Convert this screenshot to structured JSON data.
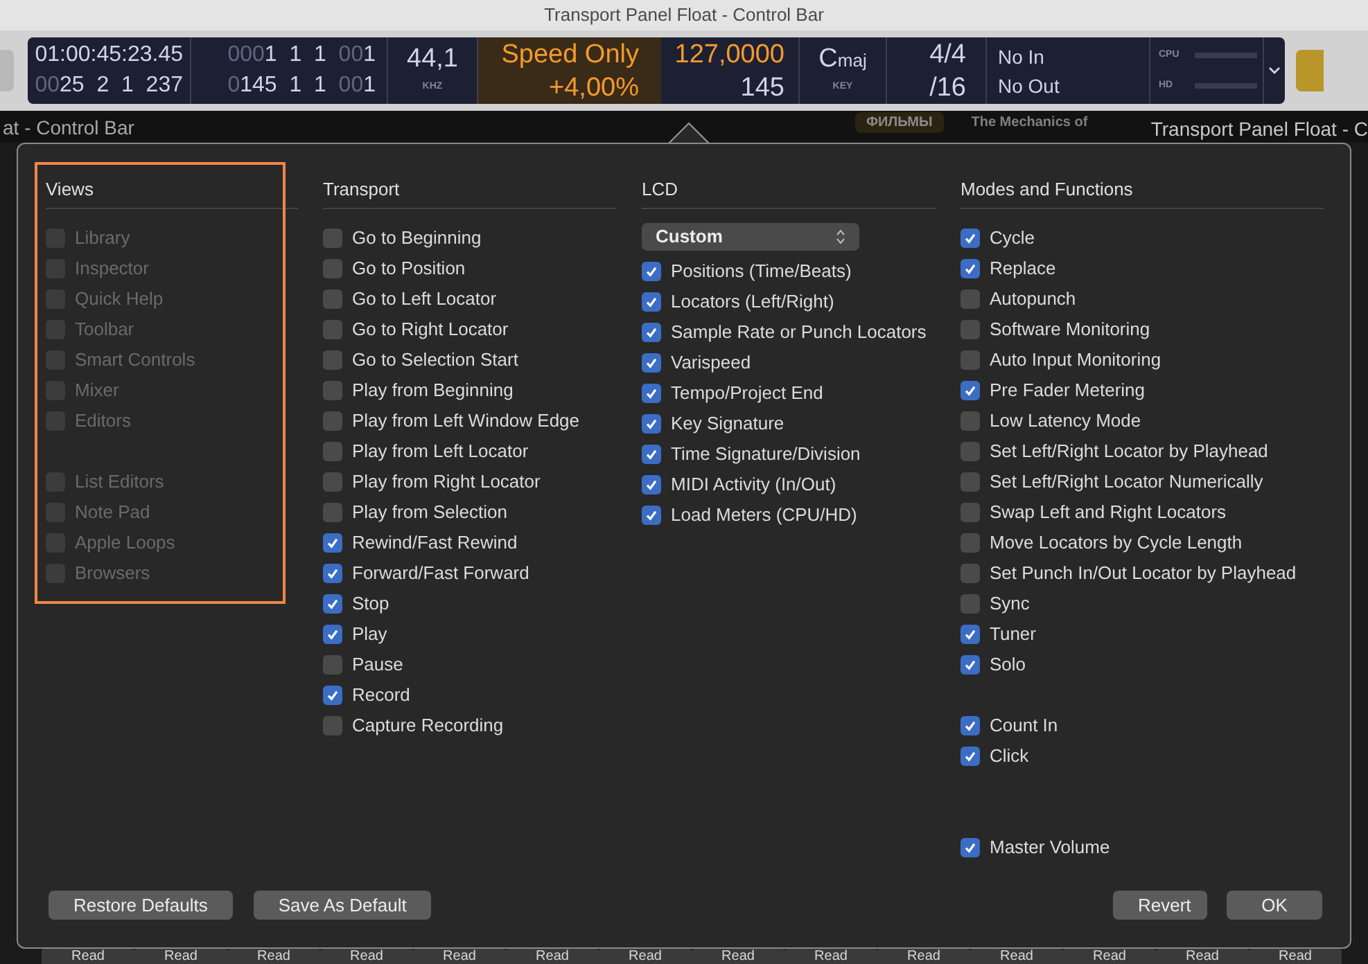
{
  "window": {
    "title": "Transport Panel Float - Control Bar"
  },
  "lcd": {
    "time": {
      "top": [
        {
          "text": "01:00:45:23.45",
          "dim": false
        }
      ],
      "bottom": [
        {
          "text": "00",
          "dim": true
        },
        {
          "text": "25  2  1  237",
          "dim": false
        }
      ]
    },
    "bars": {
      "top": [
        {
          "text": "000",
          "dim": true
        },
        {
          "text": "1  1  1  ",
          "dim": false
        },
        {
          "text": "00",
          "dim": true
        },
        {
          "text": "1",
          "dim": false
        }
      ],
      "bottom": [
        {
          "text": "0",
          "dim": true
        },
        {
          "text": "145  1  1  ",
          "dim": false
        },
        {
          "text": "00",
          "dim": true
        },
        {
          "text": "1",
          "dim": false
        }
      ]
    },
    "sample_rate": {
      "value": "44,1",
      "unit": "KHZ"
    },
    "varispeed": {
      "mode": "Speed Only",
      "value": "+4,00%"
    },
    "tempo": {
      "value": "127,0000",
      "end": "145"
    },
    "key": {
      "note": "C",
      "mode": "maj",
      "label": "KEY"
    },
    "signature": {
      "value": "4/4",
      "division": "/16"
    },
    "midi": {
      "in": "No In",
      "out": "No Out"
    },
    "meters": [
      {
        "label": "CPU"
      },
      {
        "label": "HD"
      }
    ]
  },
  "background": {
    "left_title": "at - Control Bar",
    "badge": "ФИЛЬМЫ",
    "caption": "The Mechanics of",
    "right_title": "Transport Panel Float - C",
    "track_modes": [
      "Read",
      "Read",
      "Read",
      "Read",
      "Read",
      "Read",
      "Read",
      "Read",
      "Read",
      "Read",
      "Read",
      "Read",
      "Read",
      "Read"
    ]
  },
  "dialog": {
    "views": {
      "title": "Views",
      "highlighted": true,
      "groups": [
        [
          {
            "label": "Library",
            "checked": false,
            "disabled": true
          },
          {
            "label": "Inspector",
            "checked": false,
            "disabled": true
          },
          {
            "label": "Quick Help",
            "checked": false,
            "disabled": true
          },
          {
            "label": "Toolbar",
            "checked": false,
            "disabled": true
          },
          {
            "label": "Smart Controls",
            "checked": false,
            "disabled": true
          },
          {
            "label": "Mixer",
            "checked": false,
            "disabled": true
          },
          {
            "label": "Editors",
            "checked": false,
            "disabled": true
          }
        ],
        [
          {
            "label": "List Editors",
            "checked": false,
            "disabled": true
          },
          {
            "label": "Note Pad",
            "checked": false,
            "disabled": true
          },
          {
            "label": "Apple Loops",
            "checked": false,
            "disabled": true
          },
          {
            "label": "Browsers",
            "checked": false,
            "disabled": true
          }
        ]
      ]
    },
    "transport": {
      "title": "Transport",
      "groups": [
        [
          {
            "label": "Go to Beginning",
            "checked": false,
            "disabled": false
          },
          {
            "label": "Go to Position",
            "checked": false,
            "disabled": false
          },
          {
            "label": "Go to Left Locator",
            "checked": false,
            "disabled": false
          },
          {
            "label": "Go to Right Locator",
            "checked": false,
            "disabled": false
          },
          {
            "label": "Go to Selection Start",
            "checked": false,
            "disabled": false
          },
          {
            "label": "Play from Beginning",
            "checked": false,
            "disabled": false
          },
          {
            "label": "Play from Left Window Edge",
            "checked": false,
            "disabled": false
          },
          {
            "label": "Play from Left Locator",
            "checked": false,
            "disabled": false
          },
          {
            "label": "Play from Right Locator",
            "checked": false,
            "disabled": false
          },
          {
            "label": "Play from Selection",
            "checked": false,
            "disabled": false
          },
          {
            "label": "Rewind/Fast Rewind",
            "checked": true,
            "disabled": false
          },
          {
            "label": "Forward/Fast Forward",
            "checked": true,
            "disabled": false
          },
          {
            "label": "Stop",
            "checked": true,
            "disabled": false
          },
          {
            "label": "Play",
            "checked": true,
            "disabled": false
          },
          {
            "label": "Pause",
            "checked": false,
            "disabled": false
          },
          {
            "label": "Record",
            "checked": true,
            "disabled": false
          },
          {
            "label": "Capture Recording",
            "checked": false,
            "disabled": false
          }
        ]
      ]
    },
    "lcd": {
      "title": "LCD",
      "preset": "Custom",
      "groups": [
        [
          {
            "label": "Positions (Time/Beats)",
            "checked": true,
            "disabled": false
          },
          {
            "label": "Locators (Left/Right)",
            "checked": true,
            "disabled": false
          },
          {
            "label": "Sample Rate or Punch Locators",
            "checked": true,
            "disabled": false
          },
          {
            "label": "Varispeed",
            "checked": true,
            "disabled": false
          },
          {
            "label": "Tempo/Project End",
            "checked": true,
            "disabled": false
          },
          {
            "label": "Key Signature",
            "checked": true,
            "disabled": false
          },
          {
            "label": "Time Signature/Division",
            "checked": true,
            "disabled": false
          },
          {
            "label": "MIDI Activity (In/Out)",
            "checked": true,
            "disabled": false
          },
          {
            "label": "Load Meters (CPU/HD)",
            "checked": true,
            "disabled": false
          }
        ]
      ]
    },
    "modes": {
      "title": "Modes and Functions",
      "groups": [
        [
          {
            "label": "Cycle",
            "checked": true,
            "disabled": false
          },
          {
            "label": "Replace",
            "checked": true,
            "disabled": false
          },
          {
            "label": "Autopunch",
            "checked": false,
            "disabled": false
          },
          {
            "label": "Software Monitoring",
            "checked": false,
            "disabled": false
          },
          {
            "label": "Auto Input Monitoring",
            "checked": false,
            "disabled": false
          },
          {
            "label": "Pre Fader Metering",
            "checked": true,
            "disabled": false
          },
          {
            "label": "Low Latency Mode",
            "checked": false,
            "disabled": false
          },
          {
            "label": "Set Left/Right Locator by Playhead",
            "checked": false,
            "disabled": false
          },
          {
            "label": "Set Left/Right Locator Numerically",
            "checked": false,
            "disabled": false
          },
          {
            "label": "Swap Left and Right Locators",
            "checked": false,
            "disabled": false
          },
          {
            "label": "Move Locators by Cycle Length",
            "checked": false,
            "disabled": false
          },
          {
            "label": "Set Punch In/Out Locator by Playhead",
            "checked": false,
            "disabled": false
          },
          {
            "label": "Sync",
            "checked": false,
            "disabled": false
          },
          {
            "label": "Tuner",
            "checked": true,
            "disabled": false
          },
          {
            "label": "Solo",
            "checked": true,
            "disabled": false
          }
        ],
        [
          {
            "label": "Count In",
            "checked": true,
            "disabled": false
          },
          {
            "label": "Click",
            "checked": true,
            "disabled": false
          }
        ],
        [
          {
            "label": "Master Volume",
            "checked": true,
            "disabled": false
          }
        ]
      ]
    },
    "buttons_left": [
      "Restore Defaults",
      "Save As Default"
    ],
    "buttons_right": [
      "Revert",
      "OK"
    ]
  }
}
